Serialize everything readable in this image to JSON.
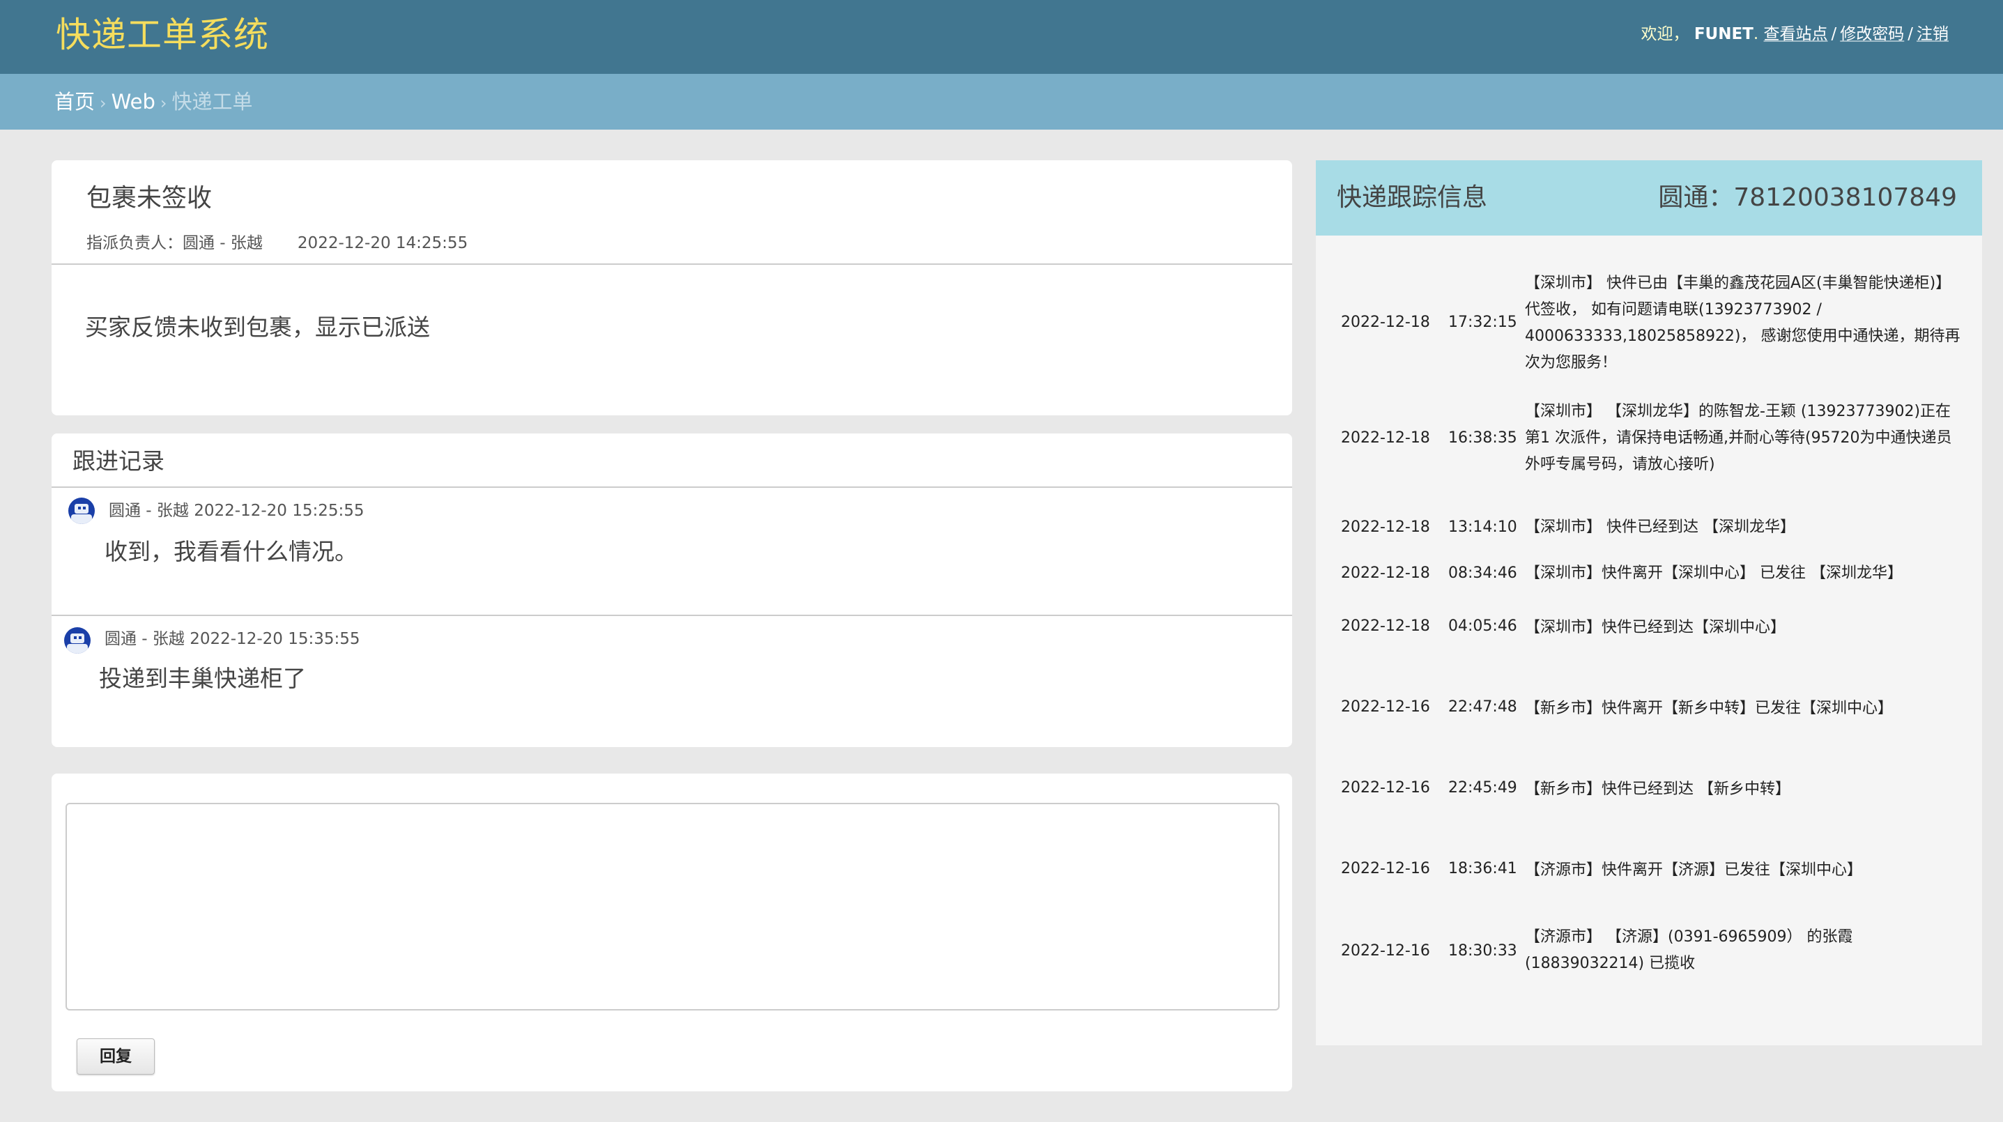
{
  "header": {
    "brand": "快递工单系统",
    "welcome": "欢迎，",
    "username": "FUNET",
    "username_suffix": ".",
    "links": [
      "查看站点",
      "修改密码",
      "注销"
    ]
  },
  "breadcrumbs": {
    "home": "首页",
    "section": "Web",
    "current": "快递工单",
    "separator": "›"
  },
  "ticket": {
    "title": "包裹未签收",
    "assignee_label": "指派负责人：圆通 - 张越",
    "created_at": "2022-12-20 14:25:55",
    "description": "买家反馈未收到包裹，显示已派送"
  },
  "followups": {
    "heading": "跟进记录",
    "entries": [
      {
        "author": "圆通 - 张越 2022-12-20 15:25:55",
        "message": "收到，我看看什么情况。"
      },
      {
        "author": "圆通 - 张越 2022-12-20 15:35:55",
        "message": "投递到丰巢快递柜了"
      }
    ]
  },
  "reply": {
    "placeholder": "",
    "button_label": "回复"
  },
  "tracking": {
    "title": "快递跟踪信息",
    "carrier_number": "圆通：78120038107849",
    "rows": [
      {
        "date": "2022-12-18",
        "time": "17:32:15",
        "content": "【深圳市】 快件已由【丰巢的鑫茂花园A区(丰巢智能快递柜)】代签收， 如有问题请电联(13923773902 / 4000633333,18025858922)， 感谢您使用中通快递，期待再次为您服务！"
      },
      {
        "date": "2022-12-18",
        "time": "16:38:35",
        "content": "【深圳市】 【深圳龙华】的陈智龙-王颖 (13923773902)正在第1 次派件，请保持电话畅通,并耐心等待(95720为中通快递员外呼专属号码，请放心接听)"
      },
      {
        "date": "2022-12-18",
        "time": "13:14:10",
        "content": "【深圳市】 快件已经到达 【深圳龙华】"
      },
      {
        "date": "2022-12-18",
        "time": "08:34:46",
        "content": "【深圳市】快件离开【深圳中心】 已发往 【深圳龙华】"
      },
      {
        "date": "2022-12-18",
        "time": "04:05:46",
        "content": "【深圳市】快件已经到达【深圳中心】"
      },
      {
        "date": "2022-12-16",
        "time": "22:47:48",
        "content": "【新乡市】快件离开【新乡中转】已发往【深圳中心】"
      },
      {
        "date": "2022-12-16",
        "time": "22:45:49",
        "content": "【新乡市】快件已经到达 【新乡中转】"
      },
      {
        "date": "2022-12-16",
        "time": "18:36:41",
        "content": "【济源市】快件离开【济源】已发往【深圳中心】"
      },
      {
        "date": "2022-12-16",
        "time": "18:30:33",
        "content": "【济源市】 【济源】(0391-6965909） 的张霞 (18839032214) 已揽收"
      }
    ]
  },
  "colors": {
    "header_bg": "#417690",
    "brand_text": "#f5dd5d",
    "breadcrumb_bg": "#79aec8",
    "tracking_header_bg": "#a8dce6"
  },
  "icons": {
    "avatar": "avatar-icon"
  }
}
